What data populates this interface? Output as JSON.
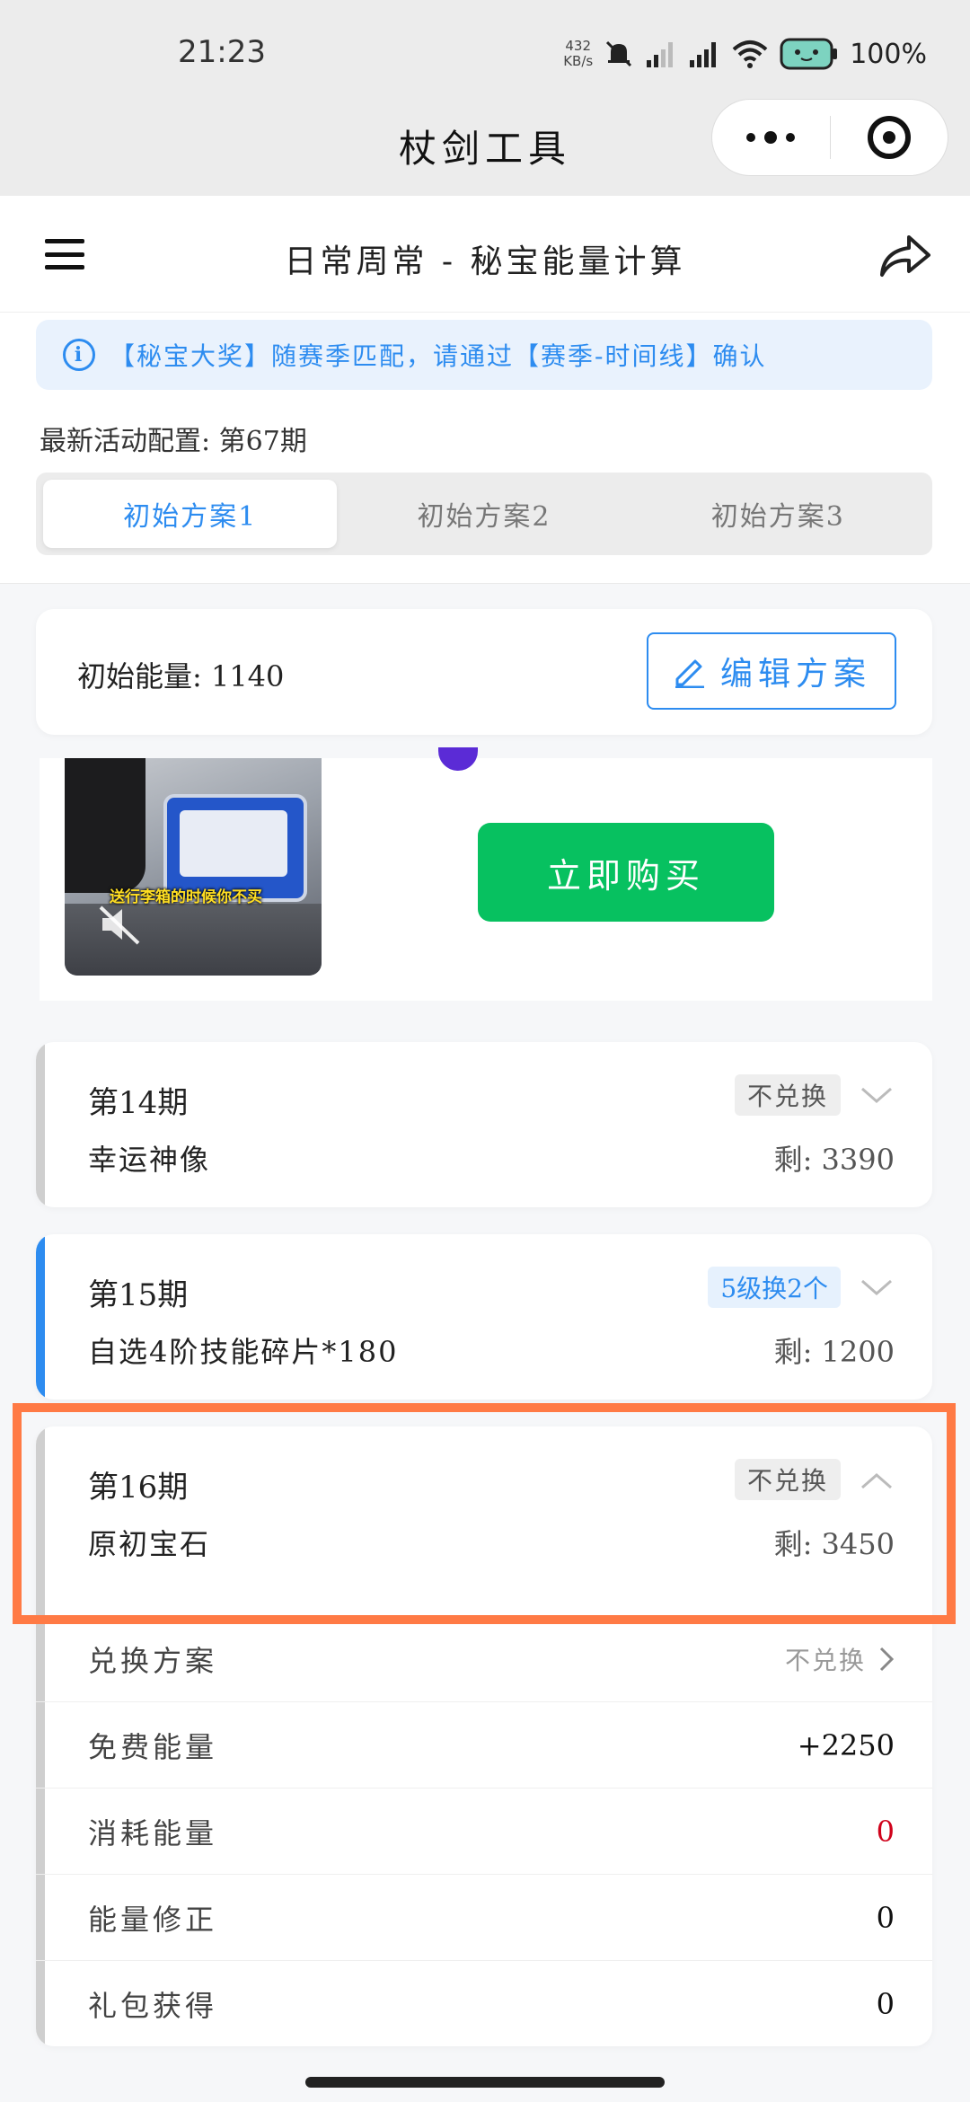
{
  "status_bar": {
    "time": "21:23",
    "net_speed_value": "432",
    "net_speed_unit": "KB/s",
    "battery": "100%"
  },
  "miniprogram": {
    "title": "杖剑工具"
  },
  "header": {
    "title": "日常周常 - 秘宝能量计算"
  },
  "notice": {
    "text": "【秘宝大奖】随赛季匹配，请通过【赛季-时间线】确认"
  },
  "config": {
    "latest": "最新活动配置: 第67期"
  },
  "plans": {
    "tabs": [
      "初始方案1",
      "初始方案2",
      "初始方案3"
    ],
    "active_index": 0
  },
  "energy": {
    "label": "初始能量: 1140",
    "edit_label": "编辑方案"
  },
  "ad": {
    "caption": "送行李箱的时候你不买",
    "buy_label": "立即购买",
    "buy_color": "#07c160"
  },
  "periods": [
    {
      "title": "第14期",
      "item": "幸运神像",
      "remain": "剩: 3390",
      "badge": "不兑换",
      "expanded": false
    },
    {
      "title": "第15期",
      "item": "自选4阶技能碎片*180",
      "remain": "剩: 1200",
      "badge": "5级换2个",
      "expanded": false
    },
    {
      "title": "第16期",
      "item": "原初宝石",
      "remain": "剩: 3450",
      "badge": "不兑换",
      "expanded": true,
      "details": [
        {
          "label": "兑换方案",
          "value": "不兑换"
        },
        {
          "label": "免费能量",
          "value": "+2250"
        },
        {
          "label": "消耗能量",
          "value": "0"
        },
        {
          "label": "能量修正",
          "value": "0"
        },
        {
          "label": "礼包获得",
          "value": "0"
        }
      ]
    }
  ],
  "colors": {
    "accent": "#2d8cf0",
    "highlight": "#ff7a45",
    "negative": "#d0021b"
  }
}
